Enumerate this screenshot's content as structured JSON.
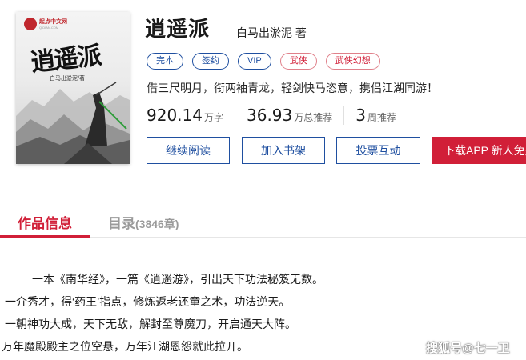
{
  "cover": {
    "logo_name": "起点中文网",
    "logo_sub": "QIDIAN.COM",
    "title": "逍遥派",
    "author": "白马出淤泥/著"
  },
  "book": {
    "title": "逍遥派",
    "author": "白马出淤泥 著",
    "tags": [
      "完本",
      "签约",
      "VIP",
      "武侠",
      "武侠幻想"
    ],
    "intro": "借三尺明月，衔两袖青龙，轻剑快马恣意，携侣江湖同游！"
  },
  "stats": [
    {
      "value": "920.14",
      "unit": "万字"
    },
    {
      "value": "36.93",
      "unit": "万总推荐"
    },
    {
      "value": "3",
      "unit": "周推荐"
    }
  ],
  "buttons": {
    "read": "继续阅读",
    "shelf": "加入书架",
    "vote": "投票互动",
    "download": "下载APP 新人免费"
  },
  "tabs": {
    "info": "作品信息",
    "catalog": "目录",
    "catalog_count": "(3846章)"
  },
  "description": [
    "一本《南华经》，一篇《逍遥游》，引出天下功法秘笈无数。",
    "一介秀才，得‘药王’指点，修炼返老还童之术，功法逆天。",
    "一朝神功大成，天下无敌，解封至尊魔刀，开启通天大阵。",
    "万年魔殿殿主之位空悬，万年江湖恩怨就此拉开。"
  ],
  "watermark": "搜狐号@七一卫",
  "colors": {
    "accent_red": "#d11f38",
    "accent_blue": "#1f4fa0"
  }
}
